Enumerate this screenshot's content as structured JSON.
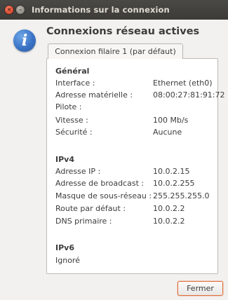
{
  "window": {
    "title": "Informations sur la connexion",
    "close_glyph": "×",
    "minimize_glyph": "–"
  },
  "icon": {
    "name": "info-icon",
    "glyph": "i",
    "color": "#3b74c6"
  },
  "heading": "Connexions réseau actives",
  "tab": {
    "label": "Connexion filaire 1 (par défaut)"
  },
  "general": {
    "title": "Général",
    "rows": [
      {
        "label": "Interface :",
        "value": "Ethernet (eth0)"
      },
      {
        "label": "Adresse matérielle :",
        "value": "08:00:27:81:91:72"
      },
      {
        "label": "Pilote :",
        "value": ""
      },
      {
        "label": "Vitesse :",
        "value": "100 Mb/s"
      },
      {
        "label": "Sécurité :",
        "value": "Aucune"
      }
    ]
  },
  "ipv4": {
    "title": "IPv4",
    "rows": [
      {
        "label": "Adresse IP :",
        "value": "10.0.2.15"
      },
      {
        "label": "Adresse de broadcast :",
        "value": "10.0.2.255"
      },
      {
        "label": "Masque de sous-réseau :",
        "value": "255.255.255.0"
      },
      {
        "label": "Route par défaut :",
        "value": "10.0.2.2"
      },
      {
        "label": "DNS primaire :",
        "value": "10.0.2.2"
      }
    ]
  },
  "ipv6": {
    "title": "IPv6",
    "status": "Ignoré"
  },
  "buttons": {
    "close_label": "Fermer"
  },
  "colors": {
    "accent": "#e1703c",
    "titlebar": "#3c3b37"
  }
}
